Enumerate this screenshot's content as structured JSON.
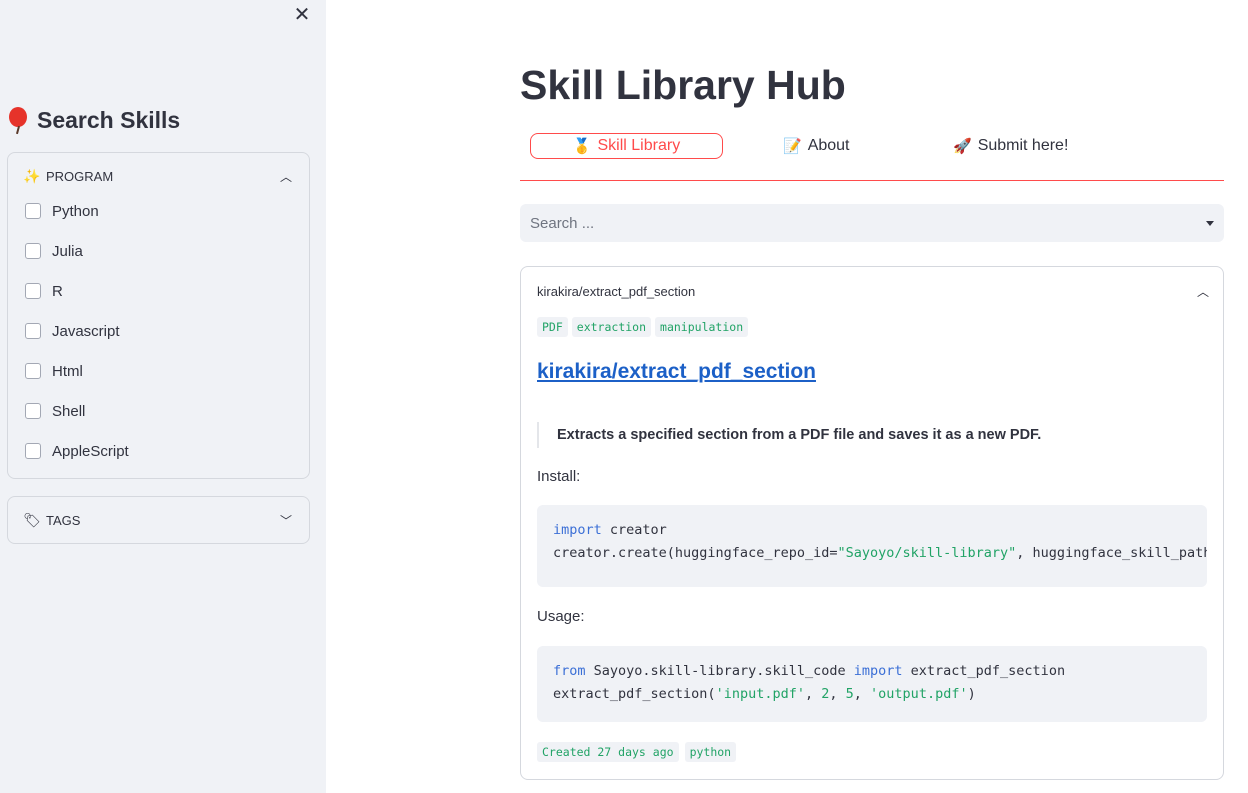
{
  "sidebar": {
    "close_label": "✕",
    "title": "Search Skills",
    "program": {
      "label": "PROGRAM",
      "icon": "sparkles-icon",
      "options": [
        "Python",
        "Julia",
        "R",
        "Javascript",
        "Html",
        "Shell",
        "AppleScript"
      ],
      "expanded": true
    },
    "tags": {
      "label": "TAGS",
      "icon": "label-tag-icon",
      "expanded": false
    }
  },
  "main": {
    "title": "Skill Library Hub",
    "tabs": [
      {
        "label": "Skill Library",
        "icon": "medal-icon",
        "active": true
      },
      {
        "label": "About",
        "icon": "memo-icon",
        "active": false
      },
      {
        "label": "Submit here!",
        "icon": "rocket-icon",
        "active": false
      }
    ],
    "search_placeholder": "Search ...",
    "card": {
      "header": "kirakira/extract_pdf_section",
      "tags": [
        "PDF",
        "extraction",
        "manipulation"
      ],
      "link": "kirakira/extract_pdf_section",
      "description": "Extracts a specified section from a PDF file and saves it as a new PDF.",
      "install_label": "Install:",
      "install_code": {
        "line1_kw": "import",
        "line1_rest": " creator",
        "line2_pre": "creator.create(huggingface_repo_id=",
        "line2_str": "\"Sayoyo/skill-library\"",
        "line2_post": ", huggingface_skill_path=\"extract_pdf_section\")"
      },
      "usage_label": "Usage:",
      "usage_code": {
        "line1_kw1": "from",
        "line1_mid": " Sayoyo.skill-library.skill_code ",
        "line1_kw2": "import",
        "line1_rest": " extract_pdf_section",
        "line2_pre": "extract_pdf_section(",
        "line2_s1": "'input.pdf'",
        "line2_c1": ", ",
        "line2_n1": "2",
        "line2_c2": ", ",
        "line2_n2": "5",
        "line2_c3": ", ",
        "line2_s2": "'output.pdf'",
        "line2_end": ")"
      },
      "footer_tags": [
        "Created 27 days ago",
        "python"
      ]
    }
  },
  "colors": {
    "accent": "#ff4b4b",
    "link": "#1c60c7",
    "tag_text": "#21a366",
    "sidebar_bg": "#f0f2f6"
  }
}
